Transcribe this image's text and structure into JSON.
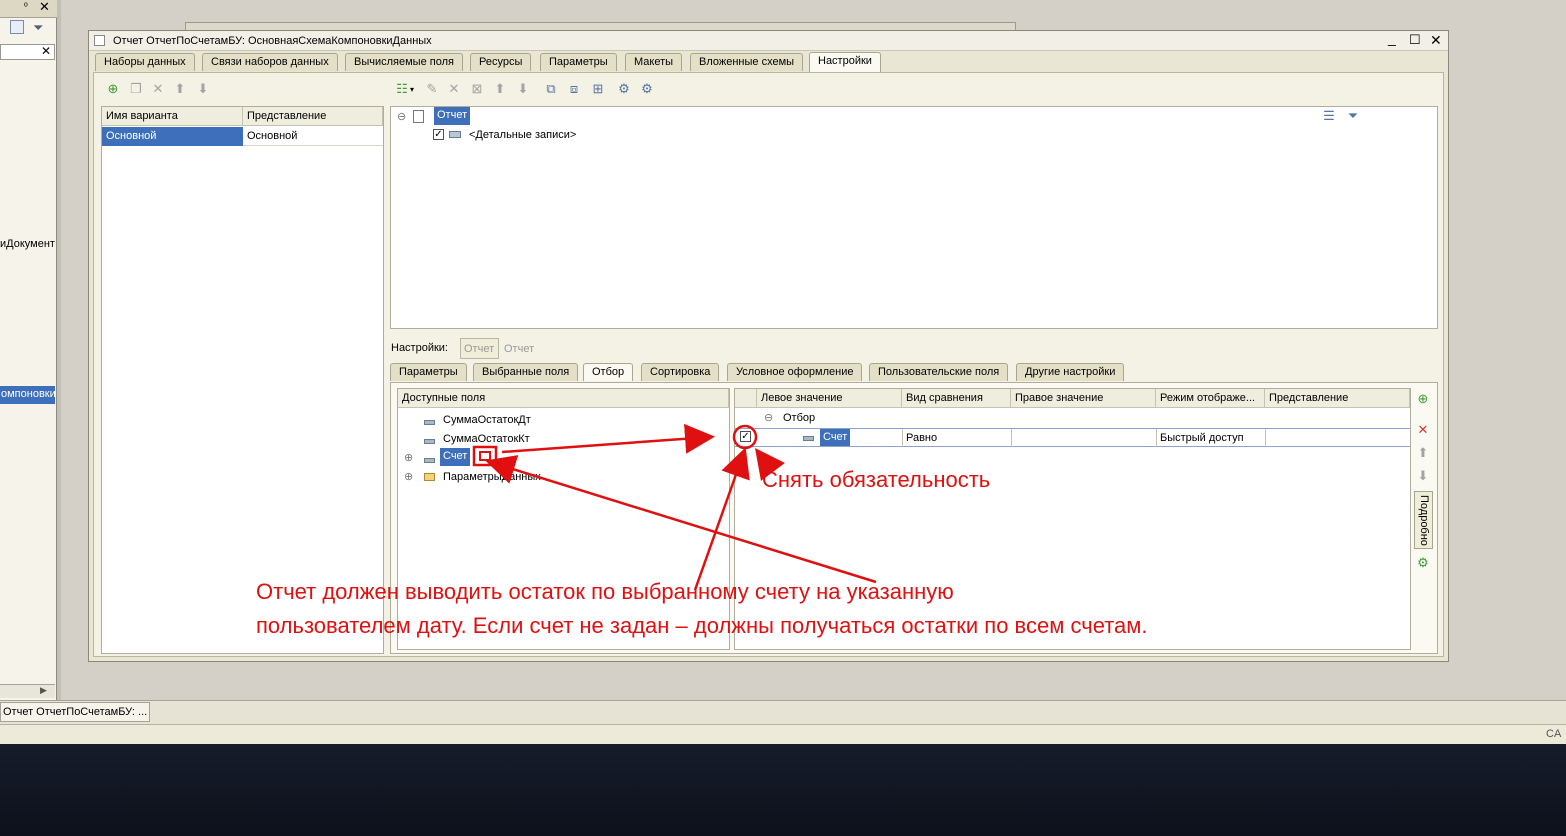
{
  "left_panel": {
    "pin": "ᵒ",
    "close": "✕",
    "search_close": "✕",
    "item_documents": "иДокумент",
    "item_selected": "омпоновки",
    "scroll_right": "▶"
  },
  "window": {
    "title": "Отчет ОтчетПоСчетамБУ: ОсновнаяСхемаКомпоновкиДанных",
    "minimize": "_",
    "maximize": "☐",
    "close": "✕",
    "tabs": [
      "Наборы данных",
      "Связи наборов данных",
      "Вычисляемые поля",
      "Ресурсы",
      "Параметры",
      "Макеты",
      "Вложенные схемы",
      "Настройки"
    ],
    "active_tab": "Настройки"
  },
  "variants": {
    "columns": [
      "Имя варианта",
      "Представление"
    ],
    "rows": [
      [
        "Основной",
        "Основной"
      ]
    ]
  },
  "structure": {
    "root": "Отчет",
    "child": "<Детальные записи>"
  },
  "settings_row": {
    "label": "Настройки:",
    "btn_report": "Отчет",
    "link_report": "Отчет"
  },
  "subtabs": [
    "Параметры",
    "Выбранные поля",
    "Отбор",
    "Сортировка",
    "Условное оформление",
    "Пользовательские поля",
    "Другие настройки"
  ],
  "active_subtab": "Отбор",
  "available_fields": {
    "header": "Доступные поля",
    "items": [
      "СуммаОстатокДт",
      "СуммаОстатокКт",
      "Счет",
      "ПараметрыДанных"
    ]
  },
  "filter_table": {
    "columns": [
      "Левое значение",
      "Вид сравнения",
      "Правое значение",
      "Режим отображе...",
      "Представление"
    ],
    "group": "Отбор",
    "row": {
      "left": "Счет",
      "comparison": "Равно",
      "right": "",
      "mode": "Быстрый доступ",
      "presentation": ""
    }
  },
  "side_panel": {
    "details": "Подробно"
  },
  "annotations": {
    "uncheck": "Снять обязательность",
    "line1": "Отчет должен выводить остаток по выбранному счету на указанную",
    "line2": "пользователем дату. Если счет не задан – должны получаться остатки по всем счетам."
  },
  "taskbar": {
    "item": "Отчет ОтчетПоСчетамБУ: ...",
    "status_right": "CA"
  },
  "colors": {
    "selection": "#3e6fba",
    "annotation": "#e01010",
    "window_bg": "#e9e6d3"
  }
}
